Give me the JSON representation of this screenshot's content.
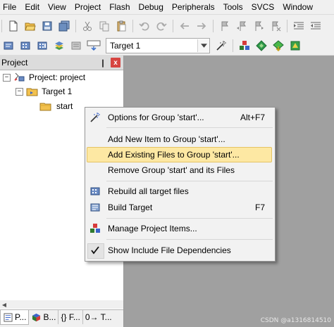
{
  "menu": [
    "File",
    "Edit",
    "View",
    "Project",
    "Flash",
    "Debug",
    "Peripherals",
    "Tools",
    "SVCS",
    "Window"
  ],
  "toolbar2": {
    "load_label": "LOAD",
    "target": "Target 1"
  },
  "project_panel": {
    "title": "Project",
    "pin": "❙",
    "close": "x",
    "tree": {
      "root": "Project: project",
      "target": "Target 1",
      "group": "start"
    },
    "tabs": [
      {
        "label": "P..."
      },
      {
        "label": "B..."
      },
      {
        "label": "{} F..."
      },
      {
        "label": "0→ T..."
      }
    ]
  },
  "context_menu": {
    "options": {
      "label": "Options for Group 'start'...",
      "shortcut": "Alt+F7"
    },
    "add_new": {
      "label": "Add New  Item to Group 'start'..."
    },
    "add_existing": {
      "label": "Add Existing Files to Group 'start'..."
    },
    "remove_group": {
      "label": "Remove Group 'start' and its Files"
    },
    "rebuild": {
      "label": "Rebuild all target files"
    },
    "build": {
      "label": "Build Target",
      "shortcut": "F7"
    },
    "manage": {
      "label": "Manage Project Items..."
    },
    "show_include": {
      "label": "Show Include File Dependencies"
    }
  },
  "watermark": "CSDN @a1316814510",
  "colors": {
    "menu_highlight": "#fde8a3",
    "menu_highlight_border": "#e5c365",
    "editor_background": "#a0a0a0",
    "close_button": "#d64541"
  }
}
